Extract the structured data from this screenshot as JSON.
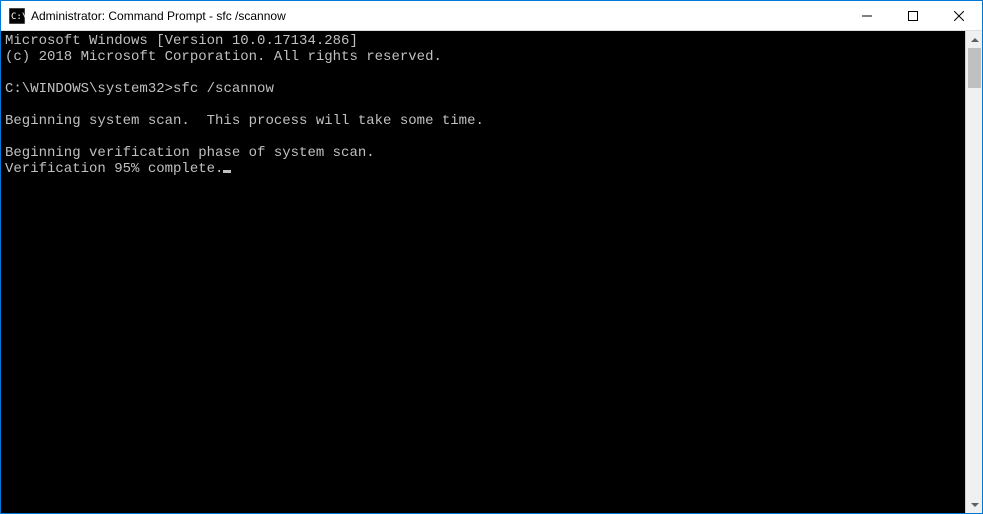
{
  "titlebar": {
    "title": "Administrator: Command Prompt - sfc  /scannow"
  },
  "console": {
    "line1": "Microsoft Windows [Version 10.0.17134.286]",
    "line2": "(c) 2018 Microsoft Corporation. All rights reserved.",
    "blank1": "",
    "prompt": "C:\\WINDOWS\\system32>",
    "command": "sfc /scannow",
    "blank2": "",
    "line3": "Beginning system scan.  This process will take some time.",
    "blank3": "",
    "line4": "Beginning verification phase of system scan.",
    "line5": "Verification 95% complete."
  }
}
